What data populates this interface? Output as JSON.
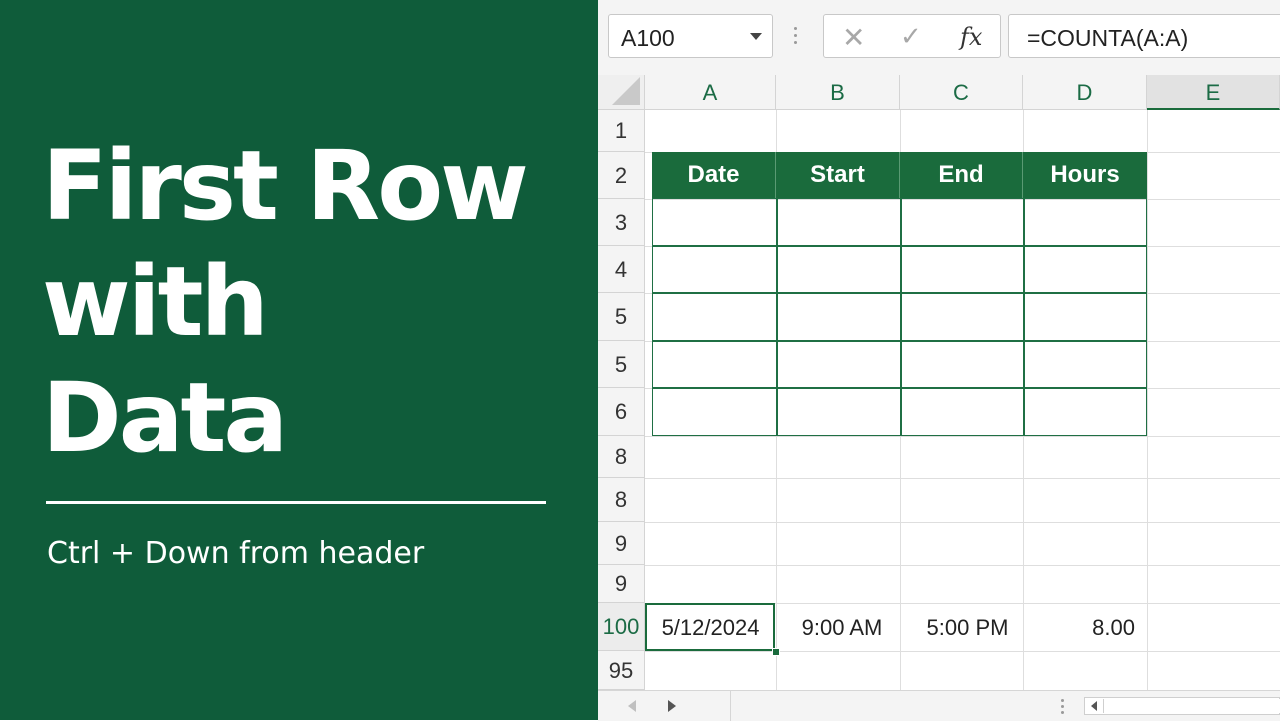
{
  "slide": {
    "title_lines": [
      "First Row",
      "with",
      "Data"
    ],
    "subtitle": "Ctrl + Down from header"
  },
  "spreadsheet": {
    "name_box": "A100",
    "formula": "=COUNTA(A:A)",
    "fx_label": "fx",
    "columns": [
      "A",
      "B",
      "C",
      "D",
      "E"
    ],
    "rows": [
      "1",
      "2",
      "3",
      "4",
      "5",
      "5",
      "6",
      "8",
      "8",
      "9",
      "9",
      "100",
      "95"
    ],
    "table_headers": [
      "Date",
      "Start",
      "End",
      "Hours"
    ],
    "data_row": {
      "date": "5/12/2024",
      "start": "9:00 AM",
      "end": "5:00 PM",
      "hours": "8.00"
    }
  },
  "colors": {
    "panel_green": "#0f5c3a",
    "header_green": "#1a6b3c"
  }
}
